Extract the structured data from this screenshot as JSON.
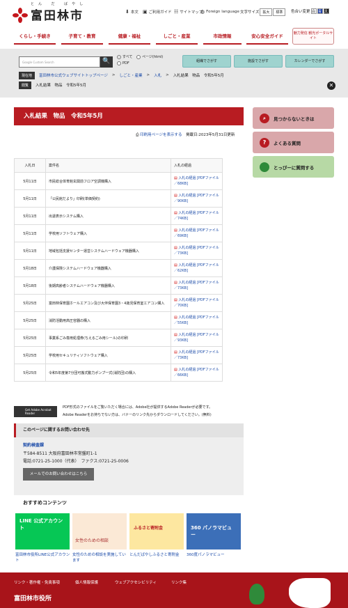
{
  "header": {
    "ruby": "とん だ ばやし",
    "logo": "富田林市",
    "links": [
      "本文",
      "ご利用ガイド",
      "サイトマップ",
      "Foreign language"
    ],
    "textsize_label": "文字サイズ",
    "enlarge": "拡大",
    "standard": "標準",
    "color_label": "色合い変更",
    "colors": [
      "白",
      "青",
      "黒"
    ]
  },
  "nav": [
    "くらし・手続き",
    "子育て・教育",
    "健康・福祉",
    "しごと・産業",
    "市政情報",
    "安心安全ガイド"
  ],
  "nav_banner": "魅力発信 観光ポータルサイト",
  "search": {
    "placeholder": "Google Custom Search",
    "button": "🔍",
    "opt_all": "すべて",
    "opt_page": "ページ(html)",
    "opt_pdf": "PDF"
  },
  "quick": [
    "組織でさがす",
    "施設でさがす",
    "カレンダーでさがす"
  ],
  "crumb": {
    "now_tag": "現在地",
    "items": [
      "富田林市公式ウェブサイトトップページ",
      "しごと・産業",
      "入札"
    ],
    "current": "入札結果　物品　令和5年5月",
    "hist_tag": "閲覧",
    "hist": "入札結果　物品　令和5年5月"
  },
  "page": {
    "title": "入札結果　物品　令和5年5月",
    "print": "印刷用ページを表示する",
    "posted": "掲載日:2023年5月31日更新"
  },
  "table": {
    "headers": [
      "入札日",
      "案件名",
      "入札の経過"
    ],
    "rows": [
      {
        "date": "5月11日",
        "name": "市民総合体育館玄関前フロア空調機購入",
        "file": "入札の経過 [PDFファイル／68KB]"
      },
      {
        "date": "5月11日",
        "name": "「公民館だより」印刷(単価契約)",
        "file": "入札の経過 [PDFファイル／90KB]"
      },
      {
        "date": "5月11日",
        "name": "出退表示システム購入",
        "file": "入札の経過 [PDFファイル／74KB]"
      },
      {
        "date": "5月11日",
        "name": "学校用ソフトウェア購入",
        "file": "入札の経過 [PDFファイル／69KB]"
      },
      {
        "date": "5月11日",
        "name": "地域包括支援センター運営システムハードウェア機器購入",
        "file": "入札の経過 [PDFファイル／73KB]"
      },
      {
        "date": "5月18日",
        "name": "介護保険システムハードウェア機器購入",
        "file": "入札の経過 [PDFファイル／62KB]"
      },
      {
        "date": "5月18日",
        "name": "後期高齢者システムハードウェア機器購入",
        "file": "入札の経過 [PDFファイル／73KB]"
      },
      {
        "date": "5月25日",
        "name": "富田林保育園ホールエアコン及び大伴保育園3・4歳児保育室エアコン購入",
        "file": "入札の経過 [PDFファイル／70KB]"
      },
      {
        "date": "5月25日",
        "name": "消防活動用高圧容器の購入",
        "file": "入札の経過 [PDFファイル／55KB]"
      },
      {
        "date": "5月25日",
        "name": "事業系ごみ専用処理券(ちえるごみ用シール)の印刷",
        "file": "入札の経過 [PDFファイル／93KB]"
      },
      {
        "date": "5月25日",
        "name": "学校用セキュリティソフトウェア購入",
        "file": "入札の経過 [PDFファイル／73KB]"
      },
      {
        "date": "5月25日",
        "name": "令和5年度第7分団可搬式動力ポンプ一式(消防団)の購入",
        "file": "入札の経過 [PDFファイル／66KB]"
      }
    ]
  },
  "side": [
    "見つからないときは",
    "よくある質問",
    "とっぴーに質問する"
  ],
  "adobe": {
    "badge": "Get Adobe Acrobat Reader",
    "line1": "PDF形式のファイルをご覧いただく場合には、Adobe社が提供するAdobe Readerが必要です。",
    "line2": "Adobe Readerをお持ちでない方は、バナーのリンク先からダウンロードしてください。(無料)"
  },
  "contact": {
    "heading": "このページに関するお問い合わせ先",
    "dept": "契約検査課",
    "address": "〒584-8511 大阪府富田林市常盤町1-1",
    "tel": "電話:0721-25-1000（代表）　ファクス:0721-25-0006",
    "mail": "メールでのお問い合わせはこちら"
  },
  "recommend": {
    "heading": "おすすめコンテンツ",
    "items": [
      "富田林市役所LINE公式アカウント",
      "女性のための相談を実施しています",
      "とんだばやしふるさと寄附金",
      "360度パノラマビュー"
    ],
    "card_texts": [
      "LINE 公式アカウント",
      "女性のための相談",
      "ふるさと寄附金",
      "360 パノラマビュー"
    ]
  },
  "footer": {
    "links": [
      "リンク・著作権・免責事項",
      "個人情報保護",
      "ウェブアクセシビリティ",
      "リンク集"
    ],
    "name": "富田林市役所"
  }
}
